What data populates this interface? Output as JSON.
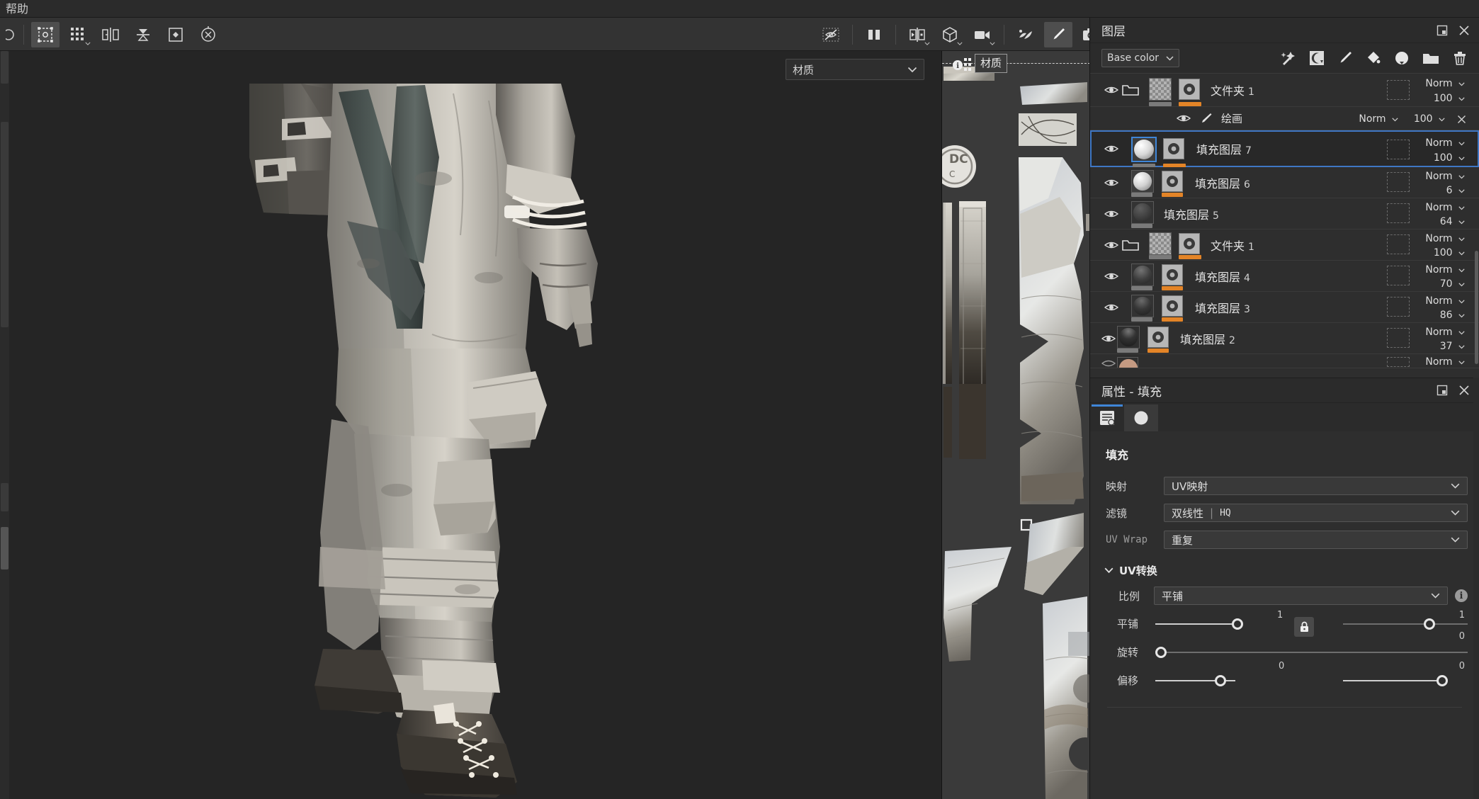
{
  "menubar": {
    "items": [
      {
        "label": "帮助"
      }
    ]
  },
  "toolbar": {
    "left_tools": [
      {
        "name": "transform-tool",
        "label": "变换",
        "active": true
      },
      {
        "name": "uv-tile-tool",
        "label": "UV 平铺",
        "active": false
      },
      {
        "name": "symmetry-tool",
        "label": "对称",
        "active": false
      },
      {
        "name": "mirror-tool",
        "label": "镜像",
        "active": false
      },
      {
        "name": "plane-tool",
        "label": "投影",
        "active": false
      },
      {
        "name": "reset-tool",
        "label": "重置",
        "active": false
      }
    ],
    "right_tools": [
      {
        "name": "hide-display-tool",
        "label": "隐藏显示",
        "active": false
      },
      {
        "name": "split-view-tool",
        "label": "分屏视图",
        "active": false
      },
      {
        "name": "viewmode-2d3d-tool",
        "label": "2D/3D 视图",
        "active": false
      },
      {
        "name": "material-mode-tool",
        "label": "材质模式",
        "active": false
      },
      {
        "name": "camera-tool",
        "label": "摄像机",
        "active": false
      },
      {
        "name": "particles-tool",
        "label": "粒子",
        "active": false
      },
      {
        "name": "paint-tool",
        "label": "绘画",
        "active": true
      },
      {
        "name": "screenshot-tool",
        "label": "截屏",
        "active": false
      }
    ]
  },
  "viewport": {
    "material_selector": {
      "value": "材质"
    },
    "uv_panel": {
      "texture_set_label": "材质"
    }
  },
  "layers_panel": {
    "title": "图层",
    "channel_selector": {
      "value": "Base color"
    },
    "toolbar_icons": [
      {
        "name": "smart-material-icon",
        "label": "智能材质"
      },
      {
        "name": "smart-mask-icon",
        "label": "智能遮罩"
      },
      {
        "name": "paint-layer-icon",
        "label": "绘画图层"
      },
      {
        "name": "fill-layer-icon",
        "label": "填充图层"
      },
      {
        "name": "adjustment-layer-icon",
        "label": "调整图层"
      },
      {
        "name": "folder-icon",
        "label": "文件夹"
      },
      {
        "name": "delete-icon",
        "label": "删除"
      }
    ],
    "rows": [
      {
        "type": "folder",
        "name": "文件夹",
        "num": "1",
        "blend": "Norm",
        "opacity": "100",
        "selected": false,
        "has_mask": true,
        "thumb": "checker"
      },
      {
        "type": "effect",
        "name": "绘画",
        "num": "",
        "blend": "Norm",
        "opacity": "100",
        "selected": false,
        "has_mask": false,
        "thumb": "none"
      },
      {
        "type": "fill",
        "name": "填充图层",
        "num": "7",
        "blend": "Norm",
        "opacity": "100",
        "selected": true,
        "has_mask": true,
        "thumb": "sphere-light"
      },
      {
        "type": "fill",
        "name": "填充图层",
        "num": "6",
        "blend": "Norm",
        "opacity": "6",
        "selected": false,
        "has_mask": true,
        "thumb": "sphere-light"
      },
      {
        "type": "fill",
        "name": "填充图层",
        "num": "5",
        "blend": "Norm",
        "opacity": "64",
        "selected": false,
        "has_mask": false,
        "thumb": "sphere-dark"
      },
      {
        "type": "folder",
        "name": "文件夹",
        "num": "1",
        "blend": "Norm",
        "opacity": "100",
        "selected": false,
        "has_mask": true,
        "thumb": "checker"
      },
      {
        "type": "fill",
        "name": "填充图层",
        "num": "4",
        "blend": "Norm",
        "opacity": "70",
        "selected": false,
        "has_mask": true,
        "thumb": "sphere-dark"
      },
      {
        "type": "fill",
        "name": "填充图层",
        "num": "3",
        "blend": "Norm",
        "opacity": "86",
        "selected": false,
        "has_mask": true,
        "thumb": "sphere-dark"
      },
      {
        "type": "fill",
        "name": "填充图层",
        "num": "2",
        "blend": "Norm",
        "opacity": "37",
        "selected": false,
        "has_mask": true,
        "thumb": "sphere-dark"
      },
      {
        "type": "fill",
        "name": "",
        "num": "",
        "blend": "Norm",
        "opacity": "",
        "selected": false,
        "has_mask": false,
        "thumb": "sphere-skin"
      }
    ]
  },
  "properties_panel": {
    "title": "属性 - 填充",
    "tabs": [
      {
        "name": "tab-properties",
        "active": true
      },
      {
        "name": "tab-material",
        "active": false
      }
    ],
    "section_title": "填充",
    "fields": [
      {
        "label": "映射",
        "value": "UV映射",
        "dim": false
      },
      {
        "label": "滤镜",
        "value_a": "双线性",
        "value_b": "HQ",
        "dim": false
      },
      {
        "label": "UV Wrap",
        "value": "重复",
        "dim": true
      }
    ],
    "uv_transform": {
      "title": "UV转换",
      "scale": {
        "label": "比例",
        "value": "平铺"
      },
      "tiling": {
        "label": "平铺",
        "u": "1",
        "v": "1",
        "locked": true
      },
      "rotation": {
        "label": "旋转",
        "value": "0"
      },
      "offset": {
        "label": "偏移",
        "u": "0",
        "v": "0"
      }
    }
  },
  "colors": {
    "accent_blue": "#3f77c4",
    "accent_orange": "#e38427",
    "panel_bg": "#2b2b2b",
    "row_bg": "#2e2e2e",
    "viewport_bg": "#252525",
    "uv_bg": "#3a3a3a"
  }
}
